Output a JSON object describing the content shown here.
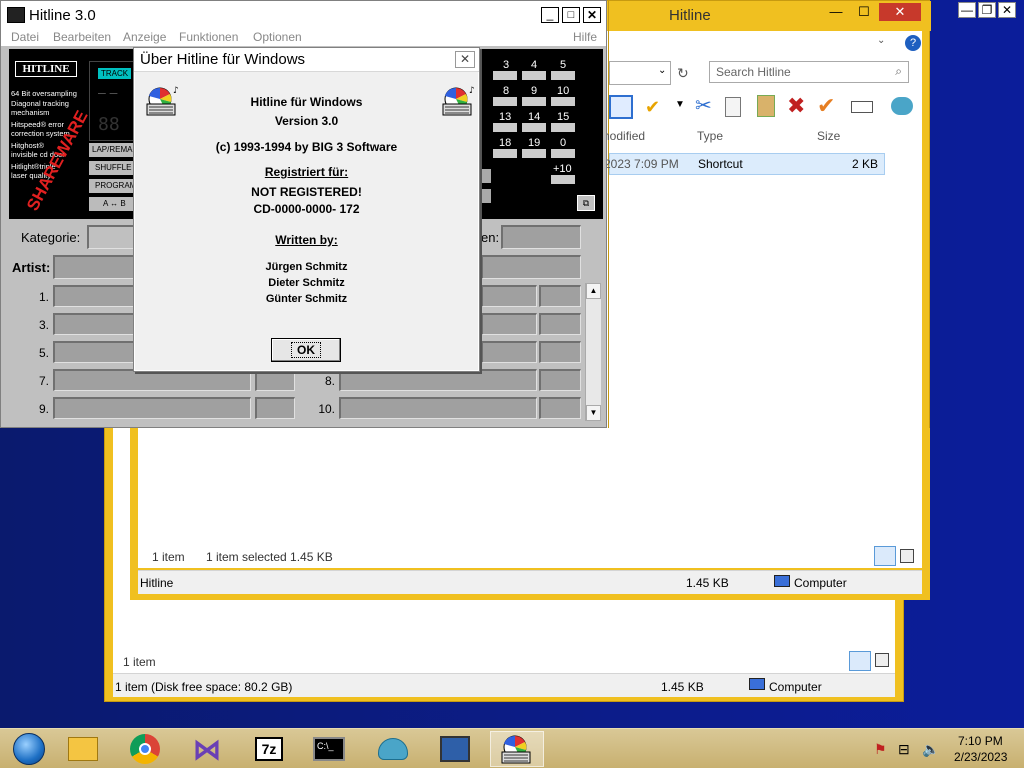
{
  "explorer_back": {
    "items_count": "1 item",
    "status_left": "1 item (Disk free space: 80.2 GB)",
    "status_size": "1.45 KB",
    "status_location": "Computer"
  },
  "explorer_front": {
    "title": "Hitline",
    "search_placeholder": "Search Hitline",
    "columns": {
      "modified": "nodified",
      "type": "Type",
      "size": "Size"
    },
    "row": {
      "modified": "2023 7:09 PM",
      "type": "Shortcut",
      "size": "2 KB"
    },
    "items_count": "1 item",
    "items_selected": "1 item selected  1.45 KB",
    "status_name": "Hitline",
    "status_size": "1.45 KB",
    "status_location": "Computer"
  },
  "hitline": {
    "title": "Hitline 3.0",
    "menu": [
      "Datei",
      "Bearbeiten",
      "Anzeige",
      "Funktionen",
      "Optionen"
    ],
    "menu_help": "Hilfe",
    "logo": "HITLINE",
    "features": [
      "64 Bit oversampling",
      "Diagonal tracking",
      "mechanism",
      "Hitspeed® error",
      "correction system",
      "Hitghost®",
      "invisible cd door",
      "Hitlight®triple",
      "laser quality"
    ],
    "shareware_stamp": "SHAREWARE",
    "track_label": "TRACK",
    "display_digits": "88",
    "buttons": [
      "LAP/REMAIN",
      "SHUFFLE",
      "PROGRAM",
      "A ↔ B"
    ],
    "keypad": [
      "3",
      "4",
      "5",
      "8",
      "9",
      "10",
      "13",
      "14",
      "15",
      "18",
      "19",
      "0",
      "+10"
    ],
    "kategorie_label": "Kategorie:",
    "right_label": "en:",
    "artist_label": "Artist:",
    "rows_left": [
      "1.",
      "3.",
      "5.",
      "7.",
      "9."
    ],
    "rows_right": [
      "8.",
      "10."
    ]
  },
  "about": {
    "title": "Über Hitline für Windows",
    "close": "✕",
    "product": "Hitline für Windows",
    "version": "Version 3.0",
    "copyright": "(c) 1993-1994 by BIG 3 Software",
    "registered_label": "Registriert für:",
    "registered_to": "NOT REGISTERED!",
    "serial": "CD-0000-0000-  172",
    "written_label": "Written by:",
    "authors": [
      "Jürgen Schmitz",
      "Dieter Schmitz",
      "Günter Schmitz"
    ],
    "ok_label": "OK"
  },
  "taskbar": {
    "time": "7:10 PM",
    "date": "2/23/2023"
  }
}
